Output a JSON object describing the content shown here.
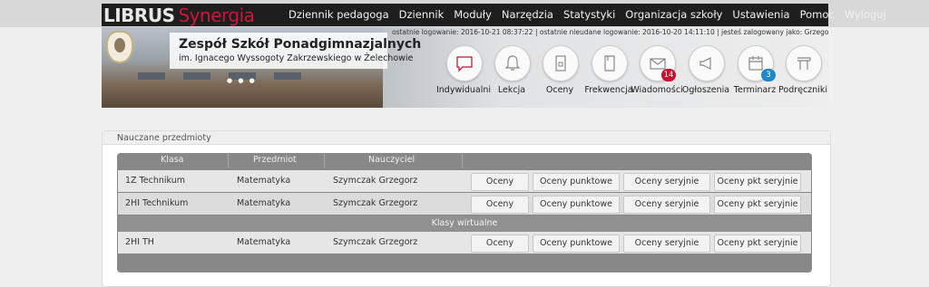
{
  "app": {
    "logo_main": "LIBRUS",
    "logo_sub": "Synergia"
  },
  "nav": [
    "Dziennik pedagoga",
    "Dziennik",
    "Moduły",
    "Narzędzia",
    "Statystyki",
    "Organizacja szkoły",
    "Ustawienia",
    "Pomoc",
    "Wyloguj"
  ],
  "school": {
    "name": "Zespół Szkół Ponadgimnazjalnych",
    "subtitle": "im. Ignacego Wyssogoty Zakrzewskiego w Żelechowie"
  },
  "loginfo": "ostatnie logowanie: 2016-10-21 08:37:22  |  ostatnie nieudane logowanie: 2016-10-20 14:11:10  |  jesteś zalogowany jako: Grzegorz Szymczak",
  "quick_icons": [
    {
      "label": "Indywidualni",
      "icon": "chat-icon"
    },
    {
      "label": "Lekcja",
      "icon": "bell-icon"
    },
    {
      "label": "Oceny",
      "icon": "grades-icon"
    },
    {
      "label": "Frekwencja",
      "icon": "attendance-icon"
    },
    {
      "label": "Wiadomości",
      "icon": "mail-icon",
      "badge": "14",
      "badge_color": "#c8102e"
    },
    {
      "label": "Ogłoszenia",
      "icon": "megaphone-icon"
    },
    {
      "label": "Terminarz",
      "icon": "calendar-icon",
      "badge": "3",
      "badge_color": "#1e88c8"
    },
    {
      "label": "Podręczniki",
      "icon": "book-icon"
    }
  ],
  "panel": {
    "title": "Nauczane przedmioty"
  },
  "table": {
    "headers": [
      "Klasa",
      "Przedmiot",
      "Nauczyciel"
    ],
    "buttons": [
      "Oceny",
      "Oceny punktowe",
      "Oceny seryjnie",
      "Oceny pkt seryjnie"
    ],
    "rows": [
      {
        "klasa": "1Z Technikum",
        "przedmiot": "Matematyka",
        "nauczyciel": "Szymczak Grzegorz"
      },
      {
        "klasa": "2HI Technikum",
        "przedmiot": "Matematyka",
        "nauczyciel": "Szymczak Grzegorz"
      }
    ],
    "virtual_label": "Klasy wirtualne",
    "virtual_rows": [
      {
        "klasa": "2HI TH",
        "przedmiot": "Matematyka",
        "nauczyciel": "Szymczak Grzegorz"
      }
    ]
  }
}
